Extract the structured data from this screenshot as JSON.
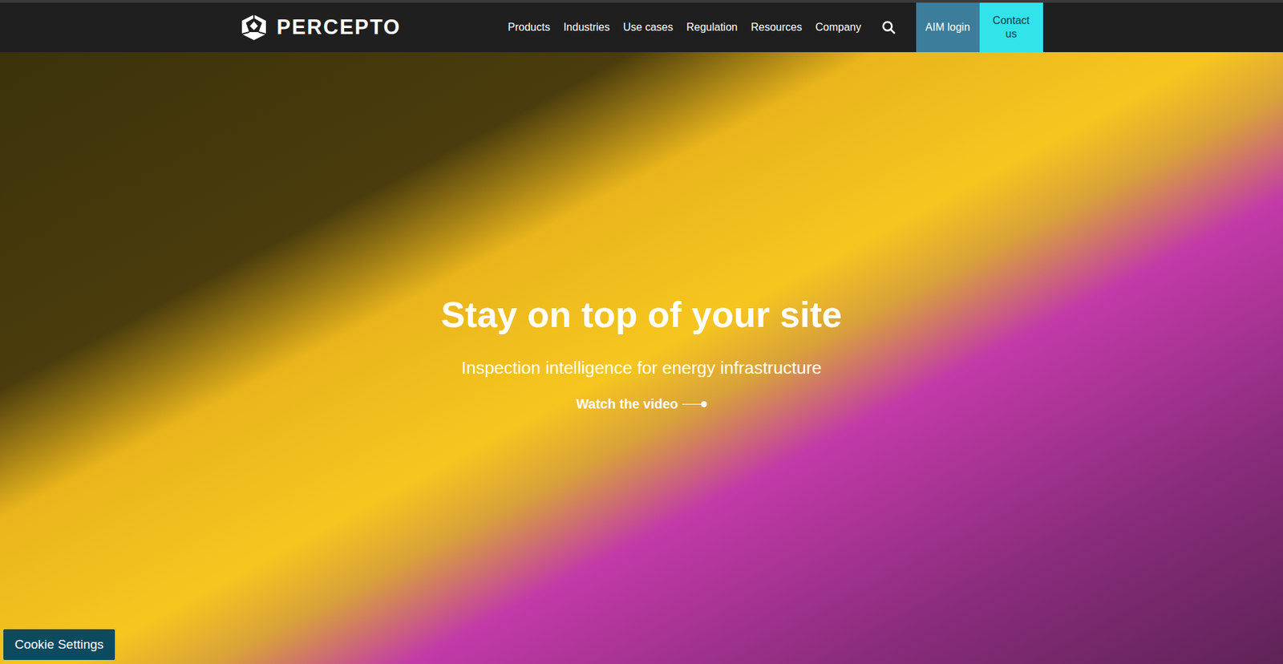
{
  "nav": {
    "logo": "PERCEPTO",
    "items": [
      {
        "label": "Products"
      },
      {
        "label": "Industries"
      },
      {
        "label": "Use cases"
      },
      {
        "label": "Regulation"
      },
      {
        "label": "Resources"
      },
      {
        "label": "Company"
      }
    ],
    "buttons": [
      {
        "label": "AIM login",
        "color": "#3c7d9b"
      },
      {
        "label": "Contact us",
        "color": "#33e3ea"
      }
    ]
  },
  "hero": {
    "title": "Stay on top of your site",
    "subtitle": "Inspection intelligence for energy infrastructure",
    "cta": "Watch the video"
  },
  "cookie_button": "Cookie Settings"
}
